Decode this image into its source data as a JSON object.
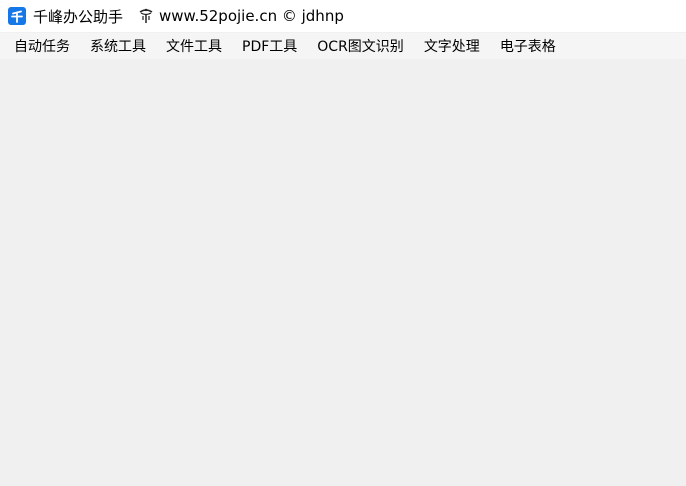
{
  "titlebar": {
    "app_title": "千峰办公助手",
    "site_text": "www.52pojie.cn © jdhnp",
    "icons": [
      "app-logo-icon",
      "pojie-logo-icon"
    ],
    "accent_color": "#1677e6"
  },
  "menubar": {
    "items": [
      {
        "label": "自动任务"
      },
      {
        "label": "系统工具"
      },
      {
        "label": "文件工具"
      },
      {
        "label": "PDF工具"
      },
      {
        "label": "OCR图文识别"
      },
      {
        "label": "文字处理"
      },
      {
        "label": "电子表格"
      }
    ]
  }
}
